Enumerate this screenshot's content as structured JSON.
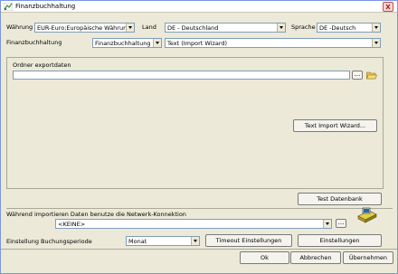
{
  "window": {
    "title": "Finanzbuchhaltung",
    "icon": "app-icon"
  },
  "row1": {
    "currency_label": "Währung",
    "currency_value": "EUR-Euro;Europäische Währung",
    "country_label": "Land",
    "country_value": "DE - Deutschland",
    "language_label": "Sprache",
    "language_value": "DE -Deutsch"
  },
  "row2": {
    "fibu_label": "Finanzbuchhaltung",
    "fibu_value": "Finanzbuchhaltung",
    "format_value": "Text (Import Wizard)"
  },
  "export": {
    "folder_label": "Ordner exportdaten",
    "folder_value": "",
    "browse_label": "...",
    "wizard_button": "Text Import Wizard..."
  },
  "test_button": "Test Datenbank",
  "network": {
    "label": "Während importieren Daten benutze die Netwerk-Konnektion",
    "value": "<KEINE>",
    "browse_label": "..."
  },
  "period": {
    "label": "Einstellung Buchungsperiode",
    "value": "Monat",
    "timeout_button": "Timeout Einstellungen",
    "settings_button": "Einstellungen"
  },
  "footer": {
    "ok": "Ok",
    "cancel": "Abbrechen",
    "apply": "Übernehmen"
  }
}
